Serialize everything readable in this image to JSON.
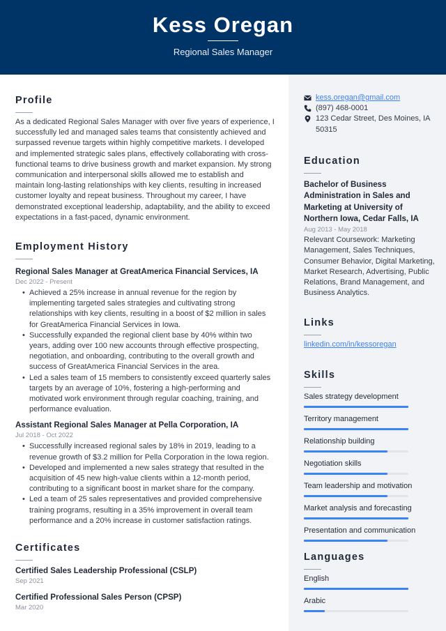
{
  "header": {
    "name": "Kess Oregan",
    "title": "Regional Sales Manager",
    "background_color": "#003366"
  },
  "profile": {
    "heading": "Profile",
    "text": "As a dedicated Regional Sales Manager with over five years of experience, I successfully led and managed sales teams that consistently achieved and surpassed revenue targets within highly competitive markets. I developed and implemented strategic sales plans, effectively collaborating with cross-functional teams to drive business growth and market expansion. My strong communication and interpersonal skills allowed me to establish and maintain long-lasting relationships with key clients, resulting in increased customer loyalty and repeat business. Throughout my career, I have demonstrated exceptional leadership, adaptability, and the ability to exceed expectations in a fast-paced, dynamic environment."
  },
  "employment": {
    "heading": "Employment History",
    "jobs": [
      {
        "title": "Regional Sales Manager at GreatAmerica Financial Services, IA",
        "dates": "Dec 2022 - Present",
        "bullets": [
          "Achieved a 25% increase in annual revenue for the region by implementing targeted sales strategies and cultivating strong relationships with key clients, resulting in a boost of $2 million in sales for GreatAmerica Financial Services in Iowa.",
          "Successfully expanded the regional client base by 40% within two years, adding over 100 new accounts through effective prospecting, negotiation, and onboarding, contributing to the overall growth and success of GreatAmerica Financial Services in the area.",
          "Led a sales team of 15 members to consistently exceed quarterly sales targets by an average of 10%, fostering a high-performing and motivated work environment through regular coaching, training, and performance evaluation."
        ]
      },
      {
        "title": "Assistant Regional Sales Manager at Pella Corporation, IA",
        "dates": "Jul 2018 - Oct 2022",
        "bullets": [
          "Successfully increased regional sales by 18% in 2019, leading to a revenue growth of $3.2 million for Pella Corporation in the Iowa region.",
          "Developed and implemented a new sales strategy that resulted in the acquisition of 45 new high-value clients within a 12-month period, contributing to a significant boost in market share for the company.",
          "Led a team of 25 sales representatives and provided comprehensive training programs, resulting in a 35% improvement in overall team performance and a 20% increase in customer satisfaction ratings."
        ]
      }
    ]
  },
  "certificates": {
    "heading": "Certificates",
    "items": [
      {
        "name": "Certified Sales Leadership Professional (CSLP)",
        "date": "Sep 2021"
      },
      {
        "name": "Certified Professional Sales Person (CPSP)",
        "date": "Mar 2020"
      }
    ]
  },
  "contact": {
    "email": "kess.oregan@gmail.com",
    "phone": "(897) 468-0001",
    "address": "123 Cedar Street, Des Moines, IA 50315",
    "icons": [
      "envelope-icon",
      "phone-icon",
      "map-pin-icon"
    ]
  },
  "education": {
    "heading": "Education",
    "degree": "Bachelor of Business Administration in Sales and Marketing at University of Northern Iowa, Cedar Falls, IA",
    "dates": "Aug 2013 - May 2018",
    "coursework": "Relevant Coursework: Marketing Management, Sales Techniques, Consumer Behavior, Digital Marketing, Market Research, Advertising, Public Relations, Brand Management, and Business Analytics."
  },
  "links": {
    "heading": "Links",
    "items": [
      {
        "label": "linkedin.com/in/kessoregan"
      }
    ]
  },
  "skills": {
    "heading": "Skills",
    "accent_color": "#3b82f6",
    "items": [
      {
        "label": "Sales strategy development",
        "level": 1.0
      },
      {
        "label": "Territory management",
        "level": 1.0
      },
      {
        "label": "Relationship building",
        "level": 0.8
      },
      {
        "label": "Negotiation skills",
        "level": 0.8
      },
      {
        "label": "Team leadership and motivation",
        "level": 0.8
      },
      {
        "label": "Market analysis and forecasting",
        "level": 1.0
      },
      {
        "label": "Presentation and communication",
        "level": 0.8
      }
    ]
  },
  "languages": {
    "heading": "Languages",
    "items": [
      {
        "label": "English",
        "level": 1.0
      },
      {
        "label": "Arabic",
        "level": 0.2
      }
    ]
  }
}
